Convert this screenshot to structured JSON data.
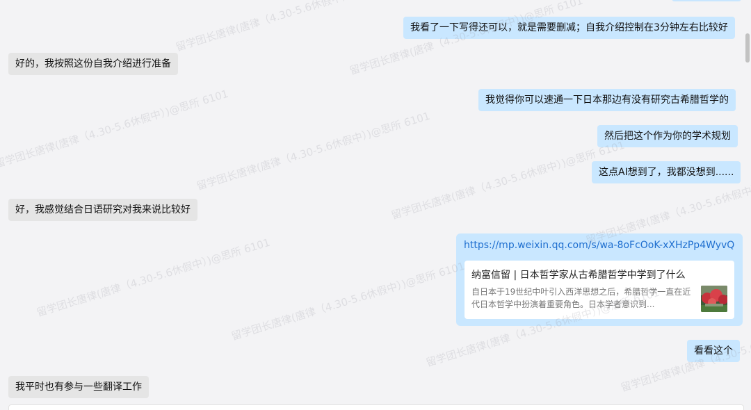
{
  "messages": {
    "m1": "我看了一下写得还可以，就是需要删减；自我介绍控制在3分钟左右比较好",
    "m2": "好的，我按照这份自我介绍进行准备",
    "m3": "我觉得你可以速通一下日本那边有没有研究古希腊哲学的",
    "m4": "然后把这个作为你的学术规划",
    "m5": "这点AI想到了，我都没想到......",
    "m6": "好，我感觉结合日语研究对我来说比较好",
    "m8": "看看这个",
    "m9": "我平时也有参与一些翻译工作"
  },
  "link_message": {
    "url": "https://mp.weixin.qq.com/s/wa-8oFcOoK-xXHzPp4WyvQ",
    "card_title": "纳富信留 | 日本哲学家从古希腊哲学中学到了什么",
    "card_description": "自日本于19世纪中叶引入西洋思想之后，希腊哲学一直在近代日本哲学中扮演着重要角色。日本学者意识到..."
  },
  "watermark": {
    "text": "留学团长唐律(唐律（4.30-5.6休假中）)@思所 6101"
  },
  "colors": {
    "right_bubble": "#c9e7ff",
    "left_bubble": "#e5e5e5",
    "background": "#f3f3f5",
    "link": "#1f6fcf"
  }
}
